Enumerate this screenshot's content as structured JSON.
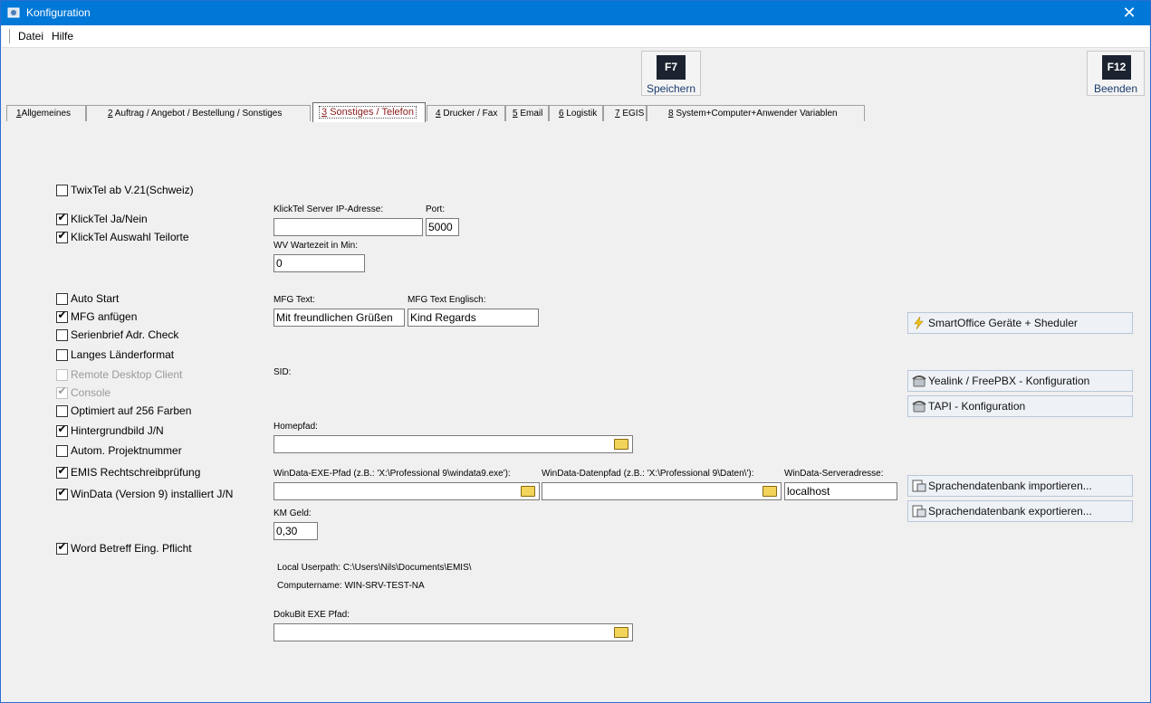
{
  "window": {
    "title": "Konfiguration",
    "close_glyph": "✕"
  },
  "menu": {
    "items": [
      "Datei",
      "Hilfe"
    ]
  },
  "toolbar": {
    "save": {
      "key": "F7",
      "label": "Speichern"
    },
    "quit": {
      "key": "F12",
      "label": "Beenden"
    }
  },
  "tabs": [
    {
      "num": "1",
      "label": "Allgemeines"
    },
    {
      "num": "2",
      "label": "Auftrag / Angebot / Bestellung / Sonstiges"
    },
    {
      "num": "3",
      "label": "Sonstiges / Telefon"
    },
    {
      "num": "4",
      "label": "Drucker / Fax"
    },
    {
      "num": "5",
      "label": "Email"
    },
    {
      "num": "6",
      "label": "Logistik"
    },
    {
      "num": "7",
      "label": "EGIS"
    },
    {
      "num": "8",
      "label": "System+Computer+Anwender Variablen"
    }
  ],
  "active_tab": "3 Sonstiges / Telefon",
  "checkboxes": [
    {
      "label": "TwixTel ab V.21(Schweiz)",
      "checked": false,
      "enabled": true
    },
    {
      "label": "KlickTel Ja/Nein",
      "checked": true,
      "enabled": true
    },
    {
      "label": "KlickTel Auswahl Teilorte",
      "checked": true,
      "enabled": true
    },
    {
      "label": "Auto Start",
      "checked": false,
      "enabled": true
    },
    {
      "label": "MFG anfügen",
      "checked": true,
      "enabled": true
    },
    {
      "label": "Serienbrief Adr. Check",
      "checked": false,
      "enabled": true
    },
    {
      "label": "Langes Länderformat",
      "checked": false,
      "enabled": true
    },
    {
      "label": "Remote Desktop Client",
      "checked": false,
      "enabled": false
    },
    {
      "label": "Console",
      "checked": true,
      "enabled": false
    },
    {
      "label": "Optimiert auf 256 Farben",
      "checked": false,
      "enabled": true
    },
    {
      "label": "Hintergrundbild J/N",
      "checked": true,
      "enabled": true
    },
    {
      "label": "Autom. Projektnummer",
      "checked": false,
      "enabled": true
    },
    {
      "label": "EMIS Rechtschreibprüfung",
      "checked": true,
      "enabled": true
    },
    {
      "label": "WinData (Version 9) installiert J/N",
      "checked": true,
      "enabled": true
    },
    {
      "label": "Word Betreff Eing. Pflicht",
      "checked": true,
      "enabled": true
    }
  ],
  "fields": {
    "klicktel_ip": {
      "label": "KlickTel Server IP-Adresse:",
      "value": ""
    },
    "port": {
      "label": "Port:",
      "value": "5000"
    },
    "wv_wait": {
      "label": "WV Wartezeit in Min:",
      "value": "0"
    },
    "mfg_text": {
      "label": "MFG Text:",
      "value": "Mit freundlichen Grüßen"
    },
    "mfg_text_en": {
      "label": "MFG Text Englisch:",
      "value": "Kind Regards"
    },
    "sid": {
      "label": "SID:"
    },
    "homepfad": {
      "label": "Homepfad:",
      "value": ""
    },
    "windata_exe": {
      "label": "WinData-EXE-Pfad (z.B.: 'X:\\Professional 9\\windata9.exe'):",
      "value": ""
    },
    "windata_data": {
      "label": "WinData-Datenpfad (z.B.: 'X:\\Professional 9\\Daten\\'):",
      "value": ""
    },
    "windata_server": {
      "label": "WinData-Serveradresse:",
      "value": "localhost"
    },
    "km_geld": {
      "label": "KM Geld:",
      "value": "0,30"
    },
    "dokubit": {
      "label": "DokuBit EXE Pfad:",
      "value": ""
    }
  },
  "info": {
    "userpath": "Local Userpath: C:\\Users\\Nils\\Documents\\EMIS\\",
    "computername": "Computername: WIN-SRV-TEST-NA"
  },
  "side_buttons": [
    {
      "label": "SmartOffice Geräte + Sheduler",
      "icon": "lightning-icon"
    },
    {
      "label": "Yealink / FreePBX - Konfiguration",
      "icon": "phone-icon"
    },
    {
      "label": "TAPI - Konfiguration",
      "icon": "phone-icon"
    },
    {
      "label": "Sprachendatenbank importieren...",
      "icon": "database-icon"
    },
    {
      "label": "Sprachendatenbank exportieren...",
      "icon": "database-icon"
    }
  ],
  "colors": {
    "titlebar": "#0078d7",
    "active_tab_text": "#8b1a1a",
    "key_badge": "#1b2330"
  }
}
